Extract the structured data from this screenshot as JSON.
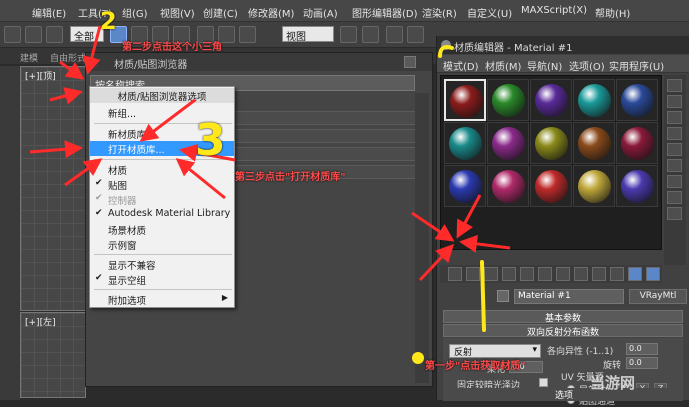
{
  "menubar": {
    "items": [
      "编辑(E)",
      "工具(T)",
      "组(G)",
      "视图(V)",
      "创建(C)",
      "修改器(M)",
      "动画(A)",
      "图形编辑器(D)",
      "渲染(R)",
      "自定义(U)",
      "MAXScript(X)",
      "帮助(H)"
    ]
  },
  "toolbar": {
    "filter_select": "全部",
    "view_select": "视图"
  },
  "cmd_row": {
    "tab1": "建模",
    "tab2": "自由形式"
  },
  "viewports": {
    "top_left": "[+][顶]",
    "bottom_left": "[+][左]"
  },
  "browser": {
    "title": "材质/贴图浏览器",
    "search_placeholder": "按名称搜索..."
  },
  "context_menu": {
    "header": "材质/贴图浏览器选项",
    "items": [
      {
        "label": "新组...",
        "check": "",
        "state": "normal"
      },
      {
        "label": "新材质库",
        "check": "",
        "state": "normal"
      },
      {
        "label": "打开材质库...",
        "check": "",
        "state": "highlight"
      },
      {
        "label": "材质",
        "check": "",
        "state": "normal"
      },
      {
        "label": "贴图",
        "check": "✔",
        "state": "normal"
      },
      {
        "label": "控制器",
        "check": "✔",
        "state": "disabled"
      },
      {
        "label": "Autodesk Material Library",
        "check": "✔",
        "state": "normal"
      },
      {
        "label": "场景材质",
        "check": "",
        "state": "normal"
      },
      {
        "label": "示例窗",
        "check": "",
        "state": "normal"
      },
      {
        "label": "显示不兼容",
        "check": "",
        "state": "normal"
      },
      {
        "label": "显示空组",
        "check": "✔",
        "state": "normal"
      },
      {
        "label": "附加选项",
        "check": "",
        "state": "normal",
        "submenu": "▶"
      }
    ]
  },
  "material_editor": {
    "title": "材质编辑器 - Material #1",
    "menu": [
      "模式(D)",
      "材质(M)",
      "导航(N)",
      "选项(O)",
      "实用程序(U)"
    ],
    "slot_colors": [
      [
        "#8b1c1c",
        "#2a8a2a",
        "#5a2a9a",
        "#1a9a9a",
        "#2a4a9a"
      ],
      [
        "#1a8a8a",
        "#8a2a8a",
        "#8a8a1a",
        "#8a4a1a",
        "#8a1a3a"
      ],
      [
        "#2a3ab0",
        "#b02a6a",
        "#c02a2a",
        "#c0a83a",
        "#4a3ab0"
      ]
    ],
    "material_name": "Material #1",
    "material_type": "VRayMtl",
    "rollout_basic": "基本参数",
    "rollout_brdf": "双向反射分布函数",
    "rollout_options": "选项",
    "brdf_type": "反射",
    "anisotropy_label": "各向异性 (-1..1)",
    "anisotropy_value": "0.0",
    "rotation_label": "旋转",
    "rotation_value": "0.0",
    "soften_label": "柔化",
    "soften_value": "0.0",
    "fix_dark_label": "固定较暗光泽边",
    "uv_label": "UV 矢量源",
    "local_axis": "局部轴",
    "axis_x": "X",
    "axis_y": "Y",
    "axis_z": "Z",
    "map_channel": "贴图通道"
  },
  "annotations": {
    "step1": "第一步\"点击获取材质\"",
    "step2": "第二步点击这个小三角",
    "step3": "第三步点击\"打开材质库\"",
    "num2": "2",
    "num3": "3"
  },
  "watermark": "当游网"
}
